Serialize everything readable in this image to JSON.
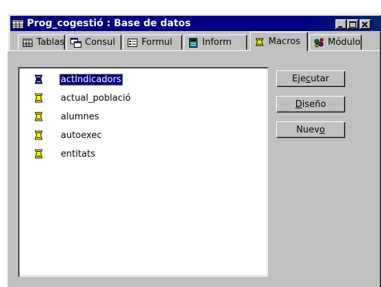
{
  "window": {
    "title": "Prog_cogestió : Base de datos"
  },
  "title_buttons": [
    "minimize",
    "maximize",
    "close"
  ],
  "tabs": [
    {
      "label": "Tablas",
      "icon": "table-icon"
    },
    {
      "label": "Consul",
      "icon": "query-icon"
    },
    {
      "label": "Formul",
      "icon": "form-icon"
    },
    {
      "label": "Inform",
      "icon": "report-icon"
    },
    {
      "label": "Macros",
      "icon": "macro-icon",
      "active": true
    },
    {
      "label": "Módulo",
      "icon": "module-icon"
    }
  ],
  "list": {
    "items": [
      {
        "label": "actIndicadors",
        "selected": true
      },
      {
        "label": "actual_població"
      },
      {
        "label": "alumnes"
      },
      {
        "label": "autoexec"
      },
      {
        "label": "entitats"
      }
    ]
  },
  "buttons": {
    "run": {
      "pre": "Eje",
      "u": "c",
      "post": "utar"
    },
    "design": {
      "pre": "",
      "u": "D",
      "post": "iseño"
    },
    "new": {
      "pre": "Nuev",
      "u": "o",
      "post": ""
    }
  },
  "colors": {
    "titlebar": "#000080",
    "face": "#c0c0c0",
    "selection": "#000080"
  }
}
